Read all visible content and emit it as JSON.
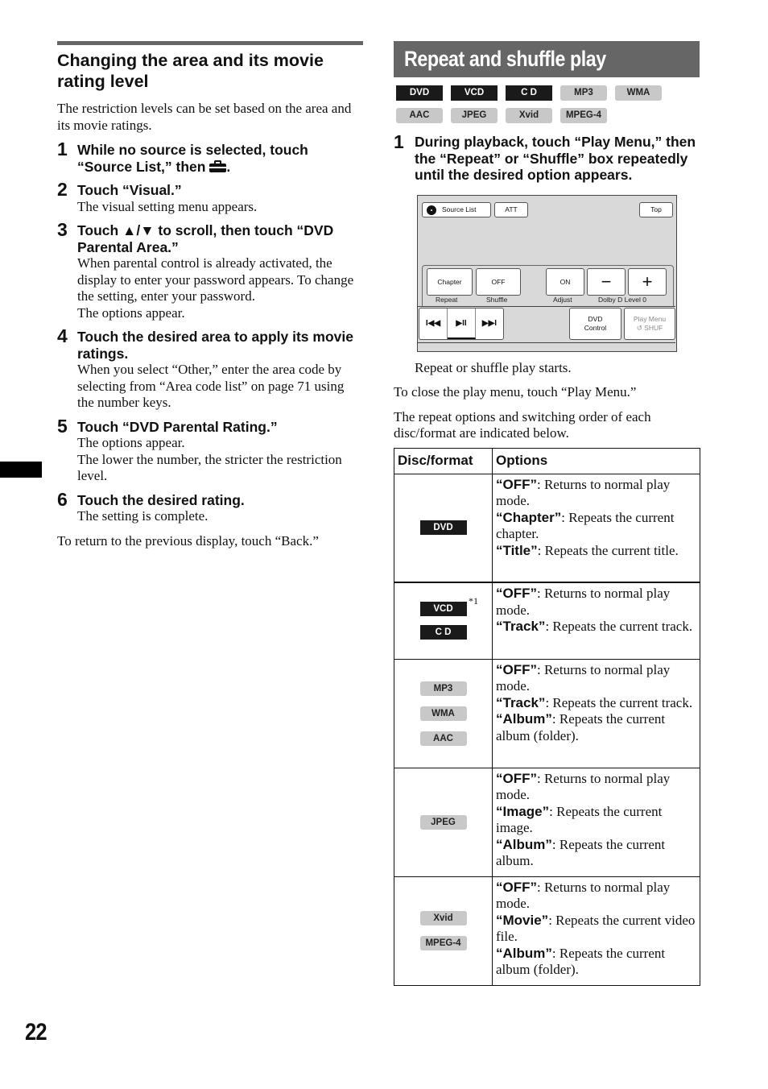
{
  "left": {
    "section_title": "Changing the area and its movie rating level",
    "intro": "The restriction levels can be set based on the area and its movie ratings.",
    "steps": [
      {
        "num": "1",
        "head_pre": "While no source is selected, touch “Source List,” then ",
        "head_post": ".",
        "icon": "toolbox-icon",
        "body": []
      },
      {
        "num": "2",
        "head": "Touch “Visual.”",
        "body": [
          "The visual setting menu appears."
        ]
      },
      {
        "num": "3",
        "head": "Touch ▲/▼ to scroll, then touch “DVD Parental Area.”",
        "body": [
          "When parental control is already activated, the display to enter your password appears. To change the setting, enter your password.",
          "The options appear."
        ]
      },
      {
        "num": "4",
        "head": "Touch the desired area to apply its movie ratings.",
        "body": [
          "When you select “Other,” enter the area code by selecting from “Area code list” on page 71 using the number keys."
        ]
      },
      {
        "num": "5",
        "head": "Touch “DVD Parental Rating.”",
        "body": [
          "The options appear.",
          "The lower the number, the stricter the restriction level."
        ]
      },
      {
        "num": "6",
        "head": "Touch the desired rating.",
        "body": [
          "The setting is complete."
        ]
      }
    ],
    "outro": "To return to the previous display, touch “Back.”"
  },
  "right": {
    "section_title": "Repeat and shuffle play",
    "badges_row1": [
      {
        "label": "DVD",
        "style": "dark"
      },
      {
        "label": "VCD",
        "style": "dark"
      },
      {
        "label": "C D",
        "style": "dark"
      },
      {
        "label": "MP3",
        "style": "light"
      },
      {
        "label": "WMA",
        "style": "light"
      }
    ],
    "badges_row2": [
      {
        "label": "AAC",
        "style": "light"
      },
      {
        "label": "JPEG",
        "style": "light"
      },
      {
        "label": "Xvid",
        "style": "light"
      },
      {
        "label": "MPEG-4",
        "style": "light"
      }
    ],
    "step": {
      "num": "1",
      "head": "During playback, touch “Play Menu,” then the “Repeat” or “Shuffle” box repeatedly until the desired option appears."
    },
    "screen": {
      "source_list": "Source List",
      "att": "ATT",
      "top": "Top",
      "repeat_value": "Chapter",
      "repeat_label": "Repeat",
      "shuffle_value": "OFF",
      "shuffle_label": "Shuffle",
      "adjust_value": "ON",
      "adjust_label": "Adjust",
      "minus": "−",
      "plus": "+",
      "dolby_label": "Dolby D Level  0",
      "prev": "I◀◀",
      "play_pause": "▶II",
      "next": "▶▶I",
      "dvd_control_line1": "DVD",
      "dvd_control_line2": "Control",
      "play_menu_line1": "Play Menu",
      "play_menu_line2": "↺ SHUF"
    },
    "result": "Repeat or shuffle play starts.",
    "close_note": "To close the play menu, touch “Play Menu.”",
    "table_intro": "The repeat options and switching order of each disc/format are indicated below.",
    "table": {
      "headers": [
        "Disc/format",
        "Options"
      ],
      "rows": [
        {
          "badges": [
            {
              "label": "DVD",
              "style": "dark"
            }
          ],
          "footnote": "",
          "options": [
            {
              "key": "“OFF”",
              "desc": ": Returns to normal play mode."
            },
            {
              "key": "“Chapter”",
              "desc": ": Repeats the current chapter."
            },
            {
              "key": "“Title”",
              "desc": ": Repeats the current title."
            }
          ]
        },
        {
          "badges": [
            {
              "label": "VCD",
              "style": "dark"
            },
            {
              "label": "C D",
              "style": "dark"
            }
          ],
          "footnote": "*1",
          "options": [
            {
              "key": "“OFF”",
              "desc": ": Returns to normal play mode."
            },
            {
              "key": "“Track”",
              "desc": ": Repeats the current track."
            }
          ]
        },
        {
          "badges": [
            {
              "label": "MP3",
              "style": "light"
            },
            {
              "label": "WMA",
              "style": "light"
            },
            {
              "label": "AAC",
              "style": "light"
            }
          ],
          "footnote": "",
          "options": [
            {
              "key": "“OFF”",
              "desc": ": Returns to normal play mode."
            },
            {
              "key": "“Track”",
              "desc": ": Repeats the current track."
            },
            {
              "key": "“Album”",
              "desc": ": Repeats the current album (folder)."
            }
          ]
        },
        {
          "badges": [
            {
              "label": "JPEG",
              "style": "light"
            }
          ],
          "footnote": "",
          "options": [
            {
              "key": "“OFF”",
              "desc": ": Returns to normal play mode."
            },
            {
              "key": "“Image”",
              "desc": ": Repeats the current image."
            },
            {
              "key": "“Album”",
              "desc": ": Repeats the current album."
            }
          ]
        },
        {
          "badges": [
            {
              "label": "Xvid",
              "style": "light"
            },
            {
              "label": "MPEG-4",
              "style": "light"
            }
          ],
          "footnote": "",
          "options": [
            {
              "key": "“OFF”",
              "desc": ": Returns to normal play mode."
            },
            {
              "key": "“Movie”",
              "desc": ": Repeats the current video file."
            },
            {
              "key": "“Album”",
              "desc": ": Repeats the current album (folder)."
            }
          ]
        }
      ]
    }
  },
  "page_number": "22"
}
